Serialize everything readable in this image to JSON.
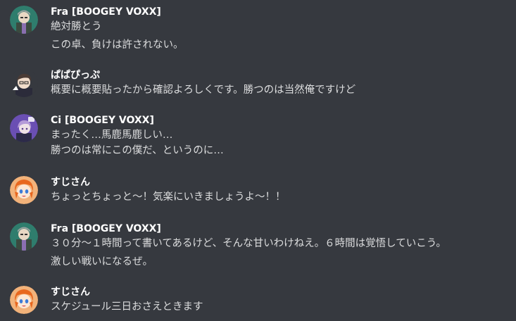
{
  "messages": [
    {
      "author": "Fra [BOOGEY VOXX]",
      "avatar": "fra-avatar",
      "lines": [
        "絶対勝とう",
        "この卓、負けは許されない。"
      ]
    },
    {
      "author": "ぱぱぴっぷ",
      "avatar": "papapippu-avatar",
      "lines": [
        "概要に概要貼ったから確認よろしくです。勝つのは当然俺ですけど"
      ]
    },
    {
      "author": "Ci [BOOGEY VOXX]",
      "avatar": "ci-avatar",
      "lines": [
        "まったく…馬鹿馬鹿しい…",
        "勝つのは常にこの僕だ、というのに…"
      ]
    },
    {
      "author": "すじさん",
      "avatar": "sujisan-avatar",
      "lines": [
        "ちょっとちょっと～！気楽にいきましょうよ～！！"
      ]
    },
    {
      "author": "Fra [BOOGEY VOXX]",
      "avatar": "fra-avatar",
      "lines": [
        "３０分～１時間って書いてあるけど、そんな甘いわけねえ。６時間は覚悟していこう。",
        "激しい戦いになるぜ。"
      ]
    },
    {
      "author": "すじさん",
      "avatar": "sujisan-avatar",
      "lines": [
        "スケジュール三日おさえときます"
      ]
    }
  ],
  "colors": {
    "background": "#36393f",
    "username": "#ffffff",
    "message_text": "#dcddde"
  }
}
